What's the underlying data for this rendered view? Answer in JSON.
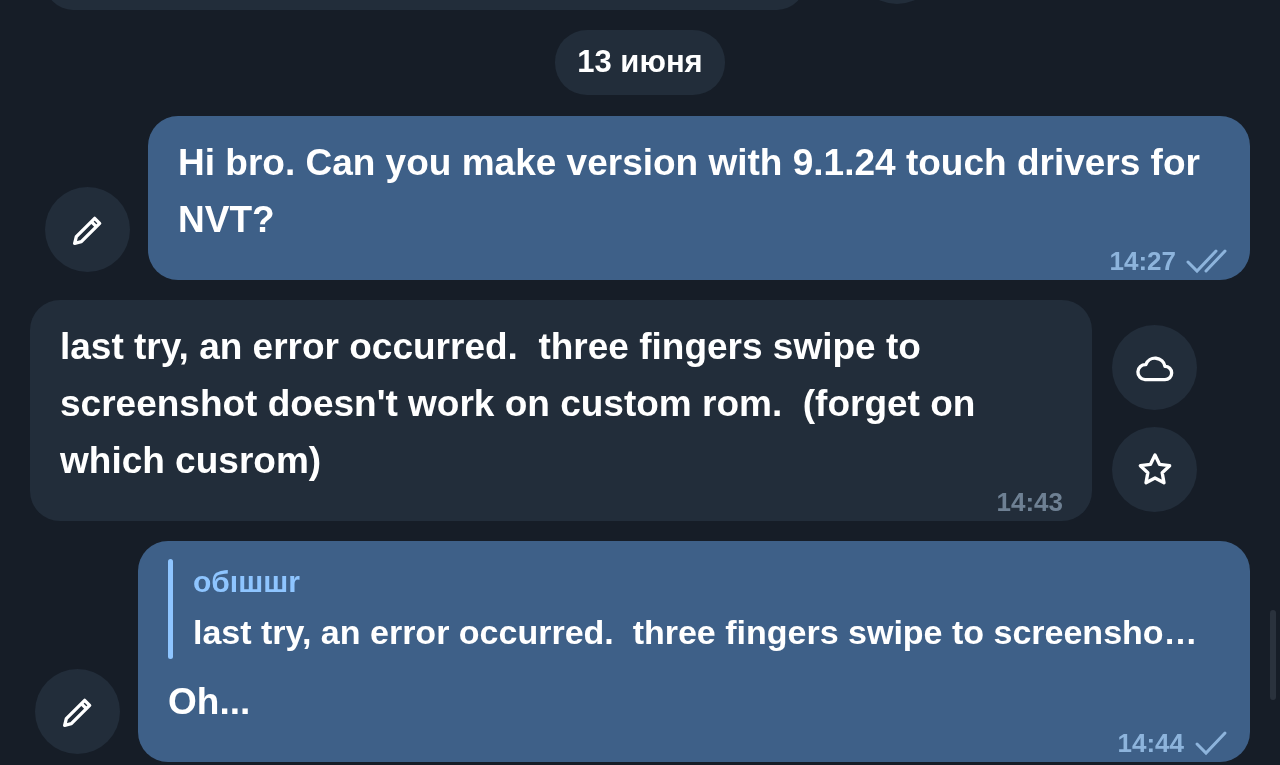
{
  "date_badge": "13 июня",
  "messages": [
    {
      "kind": "outgoing",
      "text": "Hi bro. Can you make version with 9.1.24 touch drivers for NVT?",
      "time": "14:27",
      "read": true,
      "actions": [
        {
          "kind": "edit"
        }
      ]
    },
    {
      "kind": "incoming",
      "text": "last try, an error occurred.  three fingers swipe to screenshot doesn't work on custom rom.  (forget on which cusrom)",
      "time": "14:43",
      "actions": [
        {
          "kind": "cloud"
        },
        {
          "kind": "star"
        }
      ]
    },
    {
      "kind": "outgoing",
      "reply": {
        "author": "oбıшшr",
        "text": "last try, an error occurred.  three fingers swipe to screensho…"
      },
      "text": "Oh...",
      "time": "14:44",
      "read": false,
      "actions": [
        {
          "kind": "edit"
        }
      ]
    }
  ]
}
